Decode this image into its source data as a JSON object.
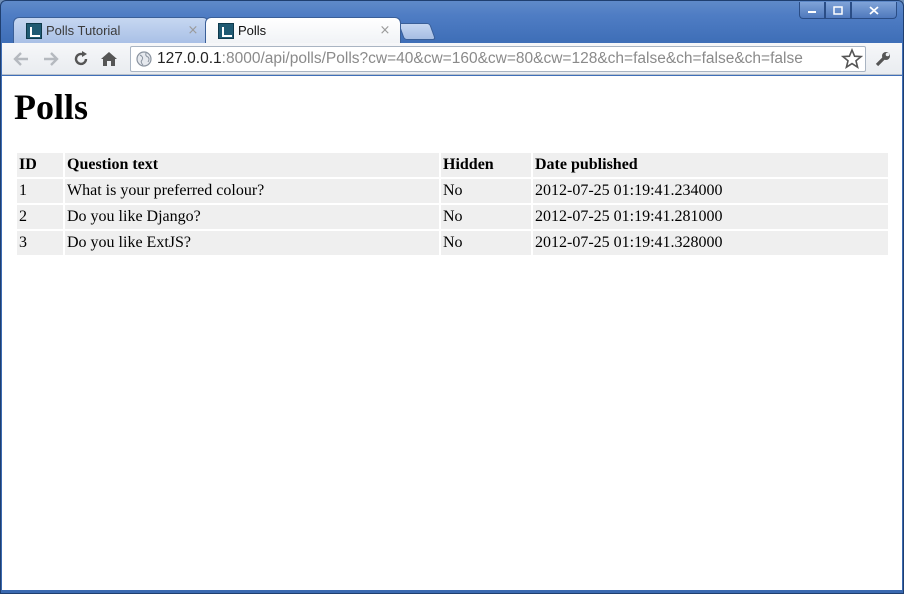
{
  "browser": {
    "tabs": [
      {
        "title": "Polls Tutorial",
        "active": false
      },
      {
        "title": "Polls",
        "active": true
      }
    ],
    "close_glyph": "×",
    "url_host": "127.0.0.1",
    "url_rest": ":8000/api/polls/Polls?cw=40&cw=160&cw=80&cw=128&ch=false&ch=false&ch=false",
    "icons": {
      "back": "back-arrow-icon",
      "forward": "forward-arrow-icon",
      "reload": "reload-icon",
      "home": "home-icon",
      "page": "globe-icon",
      "bookmark": "star-icon",
      "menu": "wrench-icon"
    }
  },
  "page": {
    "title": "Polls",
    "table": {
      "headers": [
        "ID",
        "Question text",
        "Hidden",
        "Date published"
      ],
      "rows": [
        [
          "1",
          "What is your preferred colour?",
          "No",
          "2012-07-25 01:19:41.234000"
        ],
        [
          "2",
          "Do you like Django?",
          "No",
          "2012-07-25 01:19:41.281000"
        ],
        [
          "3",
          "Do you like ExtJS?",
          "No",
          "2012-07-25 01:19:41.328000"
        ]
      ]
    }
  }
}
